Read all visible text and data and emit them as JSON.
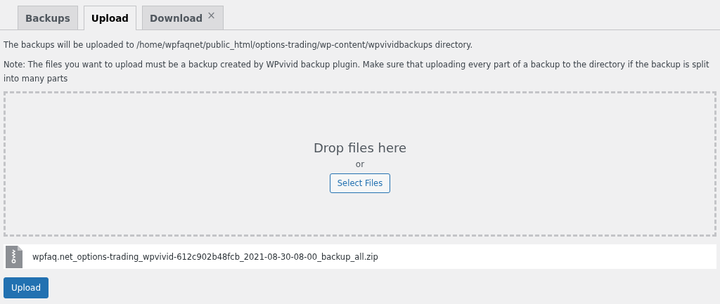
{
  "tabs": [
    {
      "label": "Backups",
      "selected": false
    },
    {
      "label": "Upload",
      "selected": true
    },
    {
      "label": "Download",
      "selected": false,
      "close": "×"
    }
  ],
  "info": "The backups will be uploaded to /home/wpfaqnet/public_html/options-trading/wp-content/wpvividbackups directory.",
  "note": "Note: The files you want to upload must be a backup created by WPvivid backup plugin. Make sure that uploading every part of a backup to the directory if the backup is split into many parts",
  "dropzone": {
    "title": "Drop files here",
    "or": "or",
    "button": "Select Files"
  },
  "files": [
    {
      "name": "wpfaq.net_options-trading_wpvivid-612c902b48fcb_2021-08-30-08-00_backup_all.zip"
    }
  ],
  "upload_button": "Upload"
}
